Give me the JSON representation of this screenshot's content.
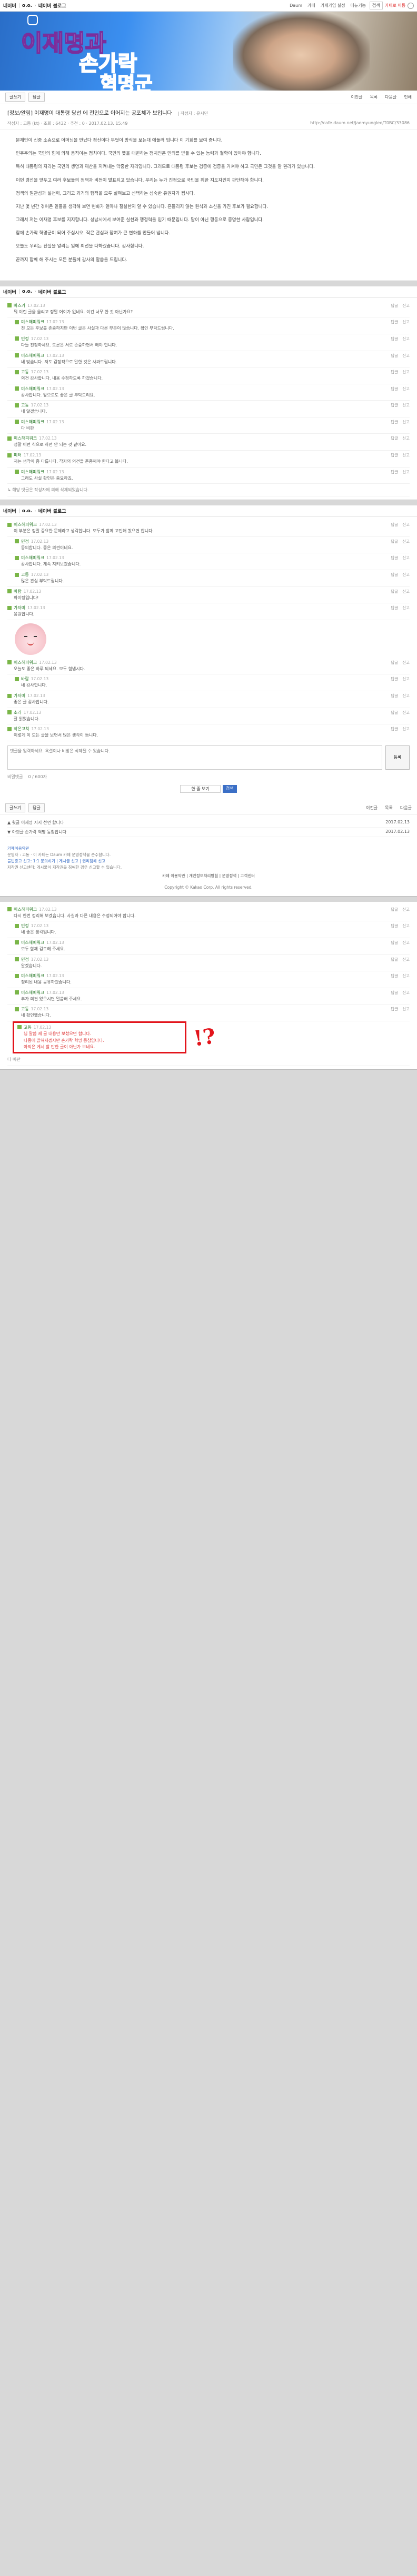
{
  "cafe": {
    "brand": "네이버",
    "cafe_name": "o.o.",
    "board": "네이버 블로그",
    "nav": [
      "Daum",
      "카페",
      "카페가입 설정",
      "메뉴기능",
      "회원가입",
      "로그아웃"
    ],
    "logout": "카페로 이동",
    "search_btn": "검색"
  },
  "banner": {
    "line1": "이재명과",
    "line2": "손가락",
    "line3": "혁명군"
  },
  "toolbar": {
    "write": "글쓰기",
    "reply": "답글",
    "right": [
      "이전글",
      "목록",
      "다음글",
      "인쇄"
    ]
  },
  "post": {
    "title": "[정보/알림] 이재명이 대통령 당선 에 전인으로 이어지는 공포체가 보입니다",
    "origin": "| 작성자 : 유시민",
    "author": "작성자 : 고동 (kt)",
    "meta_extra": "조회 : 6432 · 추천 : 0 · 2017.02.13. 15:49",
    "url": "http://cafe.daum.net/jaemyungleo/T0BC/33086",
    "paragraphs": [
      "문재인이 신중 소송으로 어머님을 만났다 정신이다 무엇이 방식을 보는대 에둘러 입니다 이 기회를 보여 줍니다.",
      "민주주의는 국민의 힘에 의해 움직이는 정치이다. 국민의 뜻을 대변하는 정치인은 민의를 받들 수 있는 능력과 철학이 있어야 합니다.",
      "특히 대통령의 자리는 국민의 생명과 재산을 지켜내는 막중한 자리입니다. 그러므로 대통령 후보는 검증에 검증을 거쳐야 하고 국민은 그것을 알 권리가 있습니다.",
      "이번 경선을 앞두고 여러 후보들의 정책과 비전이 발표되고 있습니다. 우리는 누가 진정으로 국민을 위한 지도자인지 판단해야 합니다.",
      "정책의 일관성과 실천력, 그리고 과거의 행적을 모두 살펴보고 선택하는 성숙한 유권자가 됩시다.",
      "지난 몇 년간 겪어온 일들을 생각해 보면 변화가 얼마나 절실한지 알 수 있습니다. 흔들리지 않는 원칙과 소신을 가진 후보가 필요합니다.",
      "그래서 저는 이재명 후보를 지지합니다. 성남시에서 보여준 실천과 행정력을 믿기 때문입니다. 말이 아닌 행동으로 증명한 사람입니다.",
      "함께 손가락 혁명군이 되어 주십시오. 작은 관심과 참여가 큰 변화를 만들어 냅니다.",
      "오늘도 우리는 진실을 알리는 일에 최선을 다하겠습니다. 감사합니다.",
      "끝까지 함께 해 주시는 모든 분들께 감사의 말씀을 드립니다."
    ]
  },
  "comments_a": [
    {
      "author": "바스카",
      "time": "17.02.13",
      "text": "뭐 이런 글을 올리고 정말 어이가 없네요. 이건 너무 한 것 아닌가요?",
      "reply": false
    },
    {
      "author": "미스해피워크",
      "time": "17.02.13",
      "text": "전 모든 후보를 존중하지만 이번 글은 사실과 다른 부분이 많습니다. 확인 부탁드립니다.",
      "reply": true
    },
    {
      "author": "민정",
      "time": "17.02.13",
      "text": "다들 진정하세요. 토론은 서로 존중하면서 해야 합니다.",
      "reply": true
    },
    {
      "author": "미스해피워크",
      "time": "17.02.13",
      "text": "네 맞습니다. 저도 감정적으로 말한 것은 사과드립니다.",
      "reply": true
    },
    {
      "author": "고동",
      "time": "17.02.13",
      "text": "의견 감사합니다. 내용 수정하도록 하겠습니다.",
      "reply": true
    },
    {
      "author": "미스해피워크",
      "time": "17.02.13",
      "text": "감사합니다. 앞으로도 좋은 글 부탁드려요.",
      "reply": true
    },
    {
      "author": "고동",
      "time": "17.02.13",
      "text": "네 알겠습니다.",
      "reply": true
    },
    {
      "author": "미스해피워크",
      "time": "17.02.13",
      "text": "다 비판",
      "reply": true
    },
    {
      "author": "미스해피워크",
      "time": "17.02.13",
      "text": "정말 이런 식으로 하면 안 되는 것 같아요.",
      "reply": false
    },
    {
      "author": "피터",
      "time": "17.02.13",
      "text": "저는 생각이 좀 다릅니다. 각자의 의견을 존중해야 한다고 봅니다.",
      "reply": false
    },
    {
      "author": "미스해피워크",
      "time": "17.02.13",
      "text": "그래도 사실 확인은 중요하죠.",
      "reply": true
    }
  ],
  "deleted_note": "↳ 해당 댓글은 작성자에 의해 삭제되었습니다.",
  "comments_b": [
    {
      "author": "미스해피워크",
      "time": "17.02.13",
      "text": "이 부분은 정말 중요한 문제라고 생각합니다. 모두가 함께 고민해 봤으면 합니다.",
      "reply": false
    },
    {
      "author": "민정",
      "time": "17.02.13",
      "text": "동의합니다. 좋은 의견이네요.",
      "reply": true
    },
    {
      "author": "미스해피워크",
      "time": "17.02.13",
      "text": "감사합니다. 계속 지켜보겠습니다.",
      "reply": true
    },
    {
      "author": "고동",
      "time": "17.02.13",
      "text": "많은 관심 부탁드립니다.",
      "reply": true
    },
    {
      "author": "바람",
      "time": "17.02.13",
      "text": "화이팅입니다!",
      "reply": false
    },
    {
      "author": "가자미",
      "time": "17.02.13",
      "text": "응원합니다.",
      "reply": false
    }
  ],
  "comments_c": [
    {
      "author": "미스해피워크",
      "time": "17.02.13",
      "text": "오늘도 좋은 하루 되세요. 모두 힘냅시다.",
      "reply": false
    },
    {
      "author": "바람",
      "time": "17.02.13",
      "text": "네 감사합니다.",
      "reply": true
    },
    {
      "author": "가자미",
      "time": "17.02.13",
      "text": "좋은 글 감사합니다.",
      "reply": false
    },
    {
      "author": "소라",
      "time": "17.02.13",
      "text": "잘 읽었습니다.",
      "reply": false
    },
    {
      "author": "작은고치",
      "time": "17.02.13",
      "text": "이렇게 이 모든 글을 보면서 많은 생각이 듭니다.",
      "reply": false
    }
  ],
  "write": {
    "placeholder": "댓글을 입력하세요. 욕설이나 비방은 삭제될 수 있습니다.",
    "submit": "등록",
    "options": [
      "비밀댓글",
      "0 / 600자"
    ],
    "page_select": "한 줄 보기",
    "go": "검색"
  },
  "nav_list": [
    {
      "label": "▲ 윗글  이재명 지지 선언 합니다",
      "date": "2017.02.13"
    },
    {
      "label": "▼ 아랫글  손가락 혁명 동참합니다",
      "date": "2017.02.13"
    }
  ],
  "footer": {
    "terms": "카페이용약관",
    "line1": "운영자 : 고동 · 이 카페는 Daum 카페 운영정책을 준수합니다.",
    "line2": "불법광고 신고: 1:1 문의하기 | 게시물 신고 | 권리침해 신고",
    "line3": "저작권 신고센터: 게시물이 저작권을 침해한 경우 신고할 수 있습니다.",
    "corp": "Copyright © Kakao Corp. All rights reserved.",
    "links": "카페 이용약관 | 개인정보처리방침 | 운영정책 | 고객센터"
  },
  "comments_d": [
    {
      "author": "미스해피워크",
      "time": "17.02.13",
      "text": "다시 한번 정리해 보겠습니다. 사실과 다른 내용은 수정되어야 합니다.",
      "reply": false
    },
    {
      "author": "민정",
      "time": "17.02.13",
      "text": "네 좋은 생각입니다.",
      "reply": true
    },
    {
      "author": "미스해피워크",
      "time": "17.02.13",
      "text": "모두 함께 검토해 주세요.",
      "reply": true
    },
    {
      "author": "민정",
      "time": "17.02.13",
      "text": "알겠습니다.",
      "reply": true
    },
    {
      "author": "미스해피워크",
      "time": "17.02.13",
      "text": "정리된 내용 공유하겠습니다.",
      "reply": true
    },
    {
      "author": "미스해피워크",
      "time": "17.02.13",
      "text": "추가 의견 있으시면 말씀해 주세요.",
      "reply": true
    },
    {
      "author": "고동",
      "time": "17.02.13",
      "text": "네 확인했습니다.",
      "reply": true
    }
  ],
  "highlight": {
    "author": "고동",
    "time": "17.02.13",
    "lines": [
      "님 말씀 제 글 내용만 보셨으면 합니다.",
      "나중에 밝혀지겠지만 손가락 혁명 동참입니다.",
      "아직은 게시 할 만한 글이 아닌가 보네요."
    ],
    "mark": "!?",
    "after": "다 비판"
  }
}
